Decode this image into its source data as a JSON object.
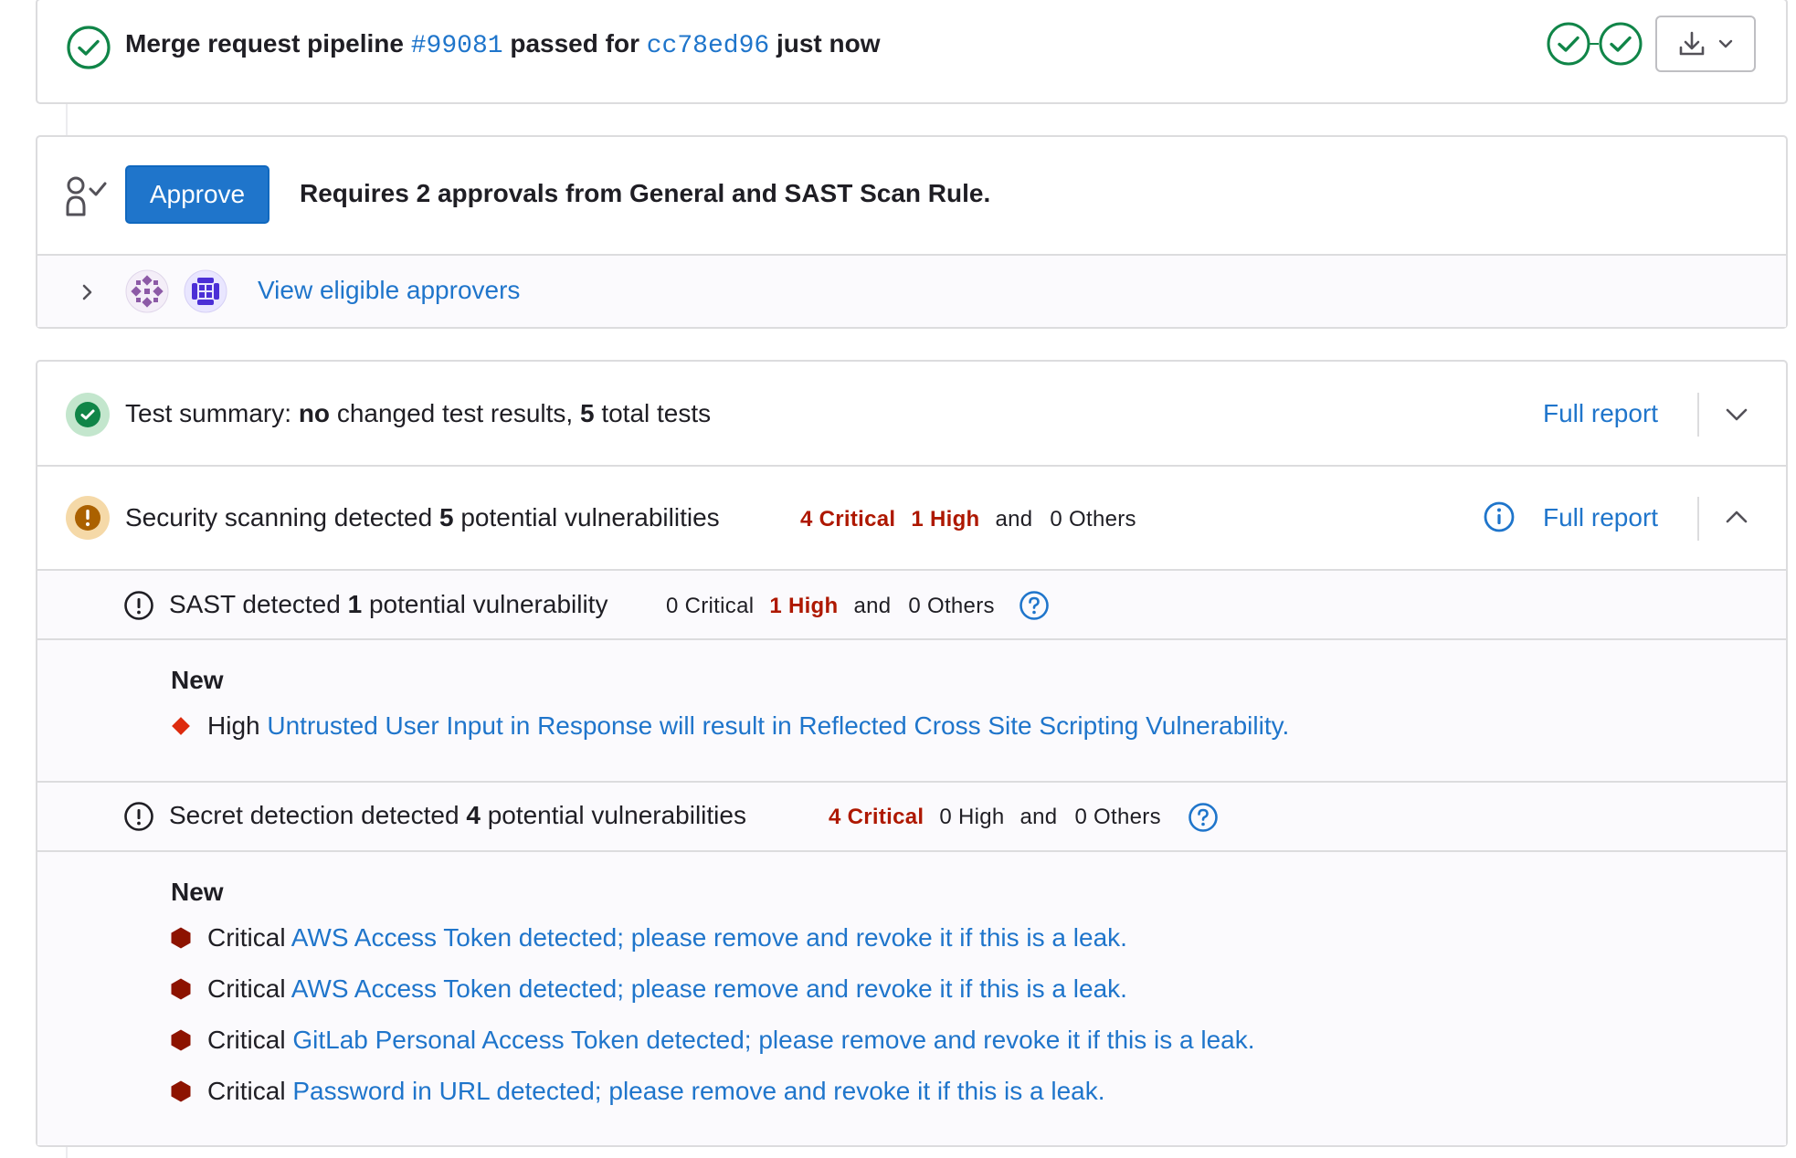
{
  "pipeline": {
    "prefix": "Merge request pipeline",
    "id": "#99081",
    "mid": "passed for",
    "commit": "cc78ed96",
    "suffix": "just now"
  },
  "approval": {
    "button": "Approve",
    "requirement": "Requires 2 approvals from General and SAST Scan Rule.",
    "view_approvers": "View eligible approvers"
  },
  "test_summary": {
    "label": "Test summary:",
    "bold1": "no",
    "mid": "changed test results,",
    "bold2": "5",
    "suffix": "total tests",
    "full_report": "Full report"
  },
  "security": {
    "prefix": "Security scanning detected",
    "count": "5",
    "suffix": "potential vulnerabilities",
    "critical": "4 Critical",
    "high": "1 High",
    "and": "and",
    "others": "0 Others",
    "full_report": "Full report"
  },
  "sast": {
    "prefix": "SAST detected",
    "count": "1",
    "suffix": "potential vulnerability",
    "critical": "0 Critical",
    "high": "1 High",
    "and": "and",
    "others": "0 Others",
    "new_label": "New",
    "items": [
      {
        "severity": "High",
        "title": "Untrusted User Input in Response will result in Reflected Cross Site Scripting Vulnerability."
      }
    ]
  },
  "secret": {
    "prefix": "Secret detection detected",
    "count": "4",
    "suffix": "potential vulnerabilities",
    "critical": "4 Critical",
    "high": "0 High",
    "and": "and",
    "others": "0 Others",
    "new_label": "New",
    "items": [
      {
        "severity": "Critical",
        "title": "AWS Access Token detected; please remove and revoke it if this is a leak."
      },
      {
        "severity": "Critical",
        "title": "AWS Access Token detected; please remove and revoke it if this is a leak."
      },
      {
        "severity": "Critical",
        "title": "GitLab Personal Access Token detected; please remove and revoke it if this is a leak."
      },
      {
        "severity": "Critical",
        "title": "Password in URL detected; please remove and revoke it if this is a leak."
      }
    ]
  },
  "colors": {
    "success": "#108548",
    "link": "#1f75cb",
    "critical": "#ae1800",
    "critical_icon": "#8d1300",
    "high_icon": "#dd2b0e",
    "warning": "#ab6100",
    "approve_button": "#1f75cb"
  }
}
